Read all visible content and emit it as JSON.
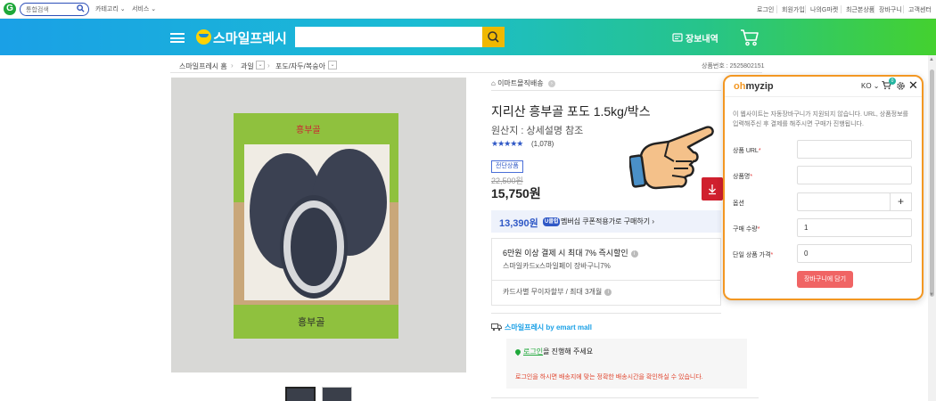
{
  "topbar": {
    "search_placeholder": "통합검색",
    "nav": [
      "카테고리 ⌄",
      "서비스 ⌄"
    ],
    "links": [
      "로그인",
      "회원가입",
      "나의G마켓",
      "최근본상품",
      "장바구니",
      "고객센터"
    ]
  },
  "header": {
    "logo_text": "스마일프레시",
    "search_value": "",
    "cart_label": "장보내역"
  },
  "breadcrumb": {
    "items": [
      "스마일프레시 홈",
      "과일",
      "포도/자두/복숭아"
    ],
    "product_number": "상품번호 : 2525802151"
  },
  "product": {
    "seller_tag": "이마트몰직배송",
    "title": "지리산 흥부골 포도 1.5kg/박스",
    "origin": "원산지 : 상세설명 참조",
    "stars": "★★★★★",
    "rating_count": "(1,078)",
    "rating_value": 4.5,
    "sale_badge": "전단상품",
    "original_price": "22,500원",
    "price": "15,750원",
    "member_price": "13,390원",
    "member_tag": "U클럽",
    "member_text": "멤버십 쿠폰적용가로 구매하기 ›",
    "benefit_title": "6만원 이상 결제 시 최대 7% 즉시할인",
    "benefit_sub": "스마일카드x스마일페이 장바구니7%",
    "benefit_card": "카드사별 무이자할부 / 최대 3개월",
    "ship_logo": "스마일프레시 by emart mall",
    "login_link": "로그인",
    "login_rest": "을 진행해 주세요",
    "login_note": "로그인을 하시면 배송지에 맞는 정확한 배송시간을 확인하실 수 있습니다."
  },
  "extension": {
    "logo_oh": "oh",
    "logo_my": "myzip",
    "lang": "KO ⌄",
    "cart_count": "0",
    "notice": "이 웹사이트는 자동장바구니가 지원되지 않습니다. URL, 상품정보를 입력해주신 후 결제를 해주시면 구매가 진행됩니다.",
    "fields": [
      {
        "label": "상품 URL",
        "required": "*",
        "value": ""
      },
      {
        "label": "상품명",
        "required": "*",
        "value": ""
      },
      {
        "label": "옵션",
        "required": "",
        "value": ""
      },
      {
        "label": "구매 수량",
        "required": "*",
        "value": "1"
      },
      {
        "label": "단일 상품 가격",
        "required": "*",
        "value": "0"
      }
    ],
    "plus": "+",
    "submit": "장바구니에 담기"
  },
  "colors": {
    "accent_orange": "#f39722",
    "brand_blue": "#2f58c6",
    "submit_red": "#f06464",
    "buy_red": "#d0202e"
  }
}
